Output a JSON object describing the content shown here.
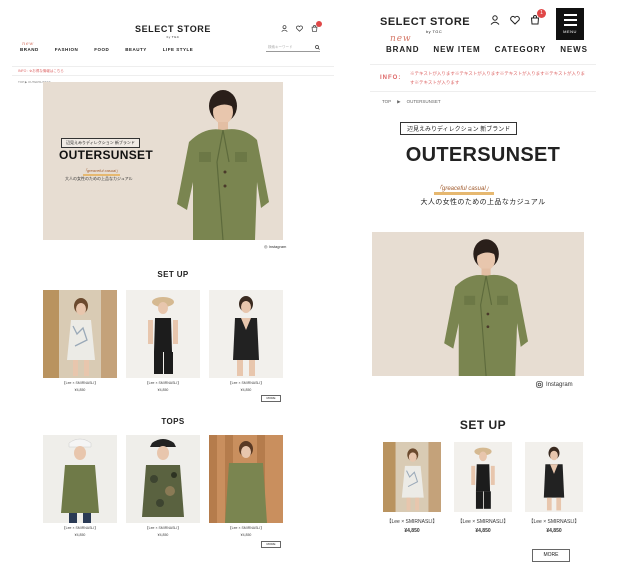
{
  "desktop": {
    "logo": "SELECT STORE",
    "logo_sub": "by TGC",
    "nav": [
      {
        "label": "BRAND",
        "new_mark": "new"
      },
      {
        "label": "FASHION"
      },
      {
        "label": "FOOD"
      },
      {
        "label": "BEAUTY"
      },
      {
        "label": "LIFE STYLE"
      }
    ],
    "search_placeholder": "検索キーワード",
    "info": "INFO : ※お得な情報はこちら",
    "breadcrumb": "TOP ▶ OUTERSUNSET",
    "hero": {
      "kicker": "辺見えみりディレクション 新ブランド",
      "title": "OUTERSUNSET",
      "tagline": "「greaceful casual」",
      "subtitle": "大人の女性のための上品なカジュアル"
    },
    "instagram": "◎ Instagram",
    "sections": [
      {
        "title": "SET UP",
        "products": [
          {
            "label": "【Lee × SMIRNASLI】",
            "price": "¥4,850"
          },
          {
            "label": "【Lee × SMIRNASLI】",
            "price": "¥4,850"
          },
          {
            "label": "【Lee × SMIRNASLI】",
            "price": "¥4,850"
          }
        ],
        "more": "MORE"
      },
      {
        "title": "TOPS",
        "products": [
          {
            "label": "【Lee × SMIRNASLI】",
            "price": "¥4,850"
          },
          {
            "label": "【Lee × SMIRNASLI】",
            "price": "¥4,850"
          },
          {
            "label": "【Lee × SMIRNASLI】",
            "price": "¥4,850"
          }
        ],
        "more": "MORE"
      }
    ]
  },
  "mobile": {
    "logo": "SELECT STORE",
    "logo_sub": "by TGC",
    "menu_label": "MENU",
    "cart_count": "1",
    "nav": [
      {
        "label": "BRAND",
        "new_mark": "new"
      },
      {
        "label": "NEW ITEM"
      },
      {
        "label": "CATEGORY"
      },
      {
        "label": "NEWS"
      }
    ],
    "info_label": "INFO:",
    "info_text": "※テキストが入ります※テキストが入ります※テキストが入ります※テキストが入ります※テキストが入ります",
    "breadcrumb": [
      "TOP",
      "▶",
      "OUTERSUNSET"
    ],
    "hero": {
      "kicker": "辺見えみりディレクション 新ブランド",
      "title": "OUTERSUNSET",
      "tagline": "「greaceful casual」",
      "subtitle": "大人の女性のための上品なカジュアル"
    },
    "instagram": "Instagram",
    "section_title": "SET UP",
    "products": [
      {
        "label": "【Lee × SMIRNASLI】",
        "price": "¥4,850"
      },
      {
        "label": "【Lee × SMIRNASLI】",
        "price": "¥4,850"
      },
      {
        "label": "【Lee × SMIRNASLI】",
        "price": "¥4,850"
      }
    ],
    "more": "MORE"
  },
  "colors": {
    "accent_red": "#e04848",
    "info_pink": "#dd6666",
    "hero_bg": "#e7ddd2",
    "jacket_green": "#7a8550",
    "tag_underline": "#e6b870"
  }
}
